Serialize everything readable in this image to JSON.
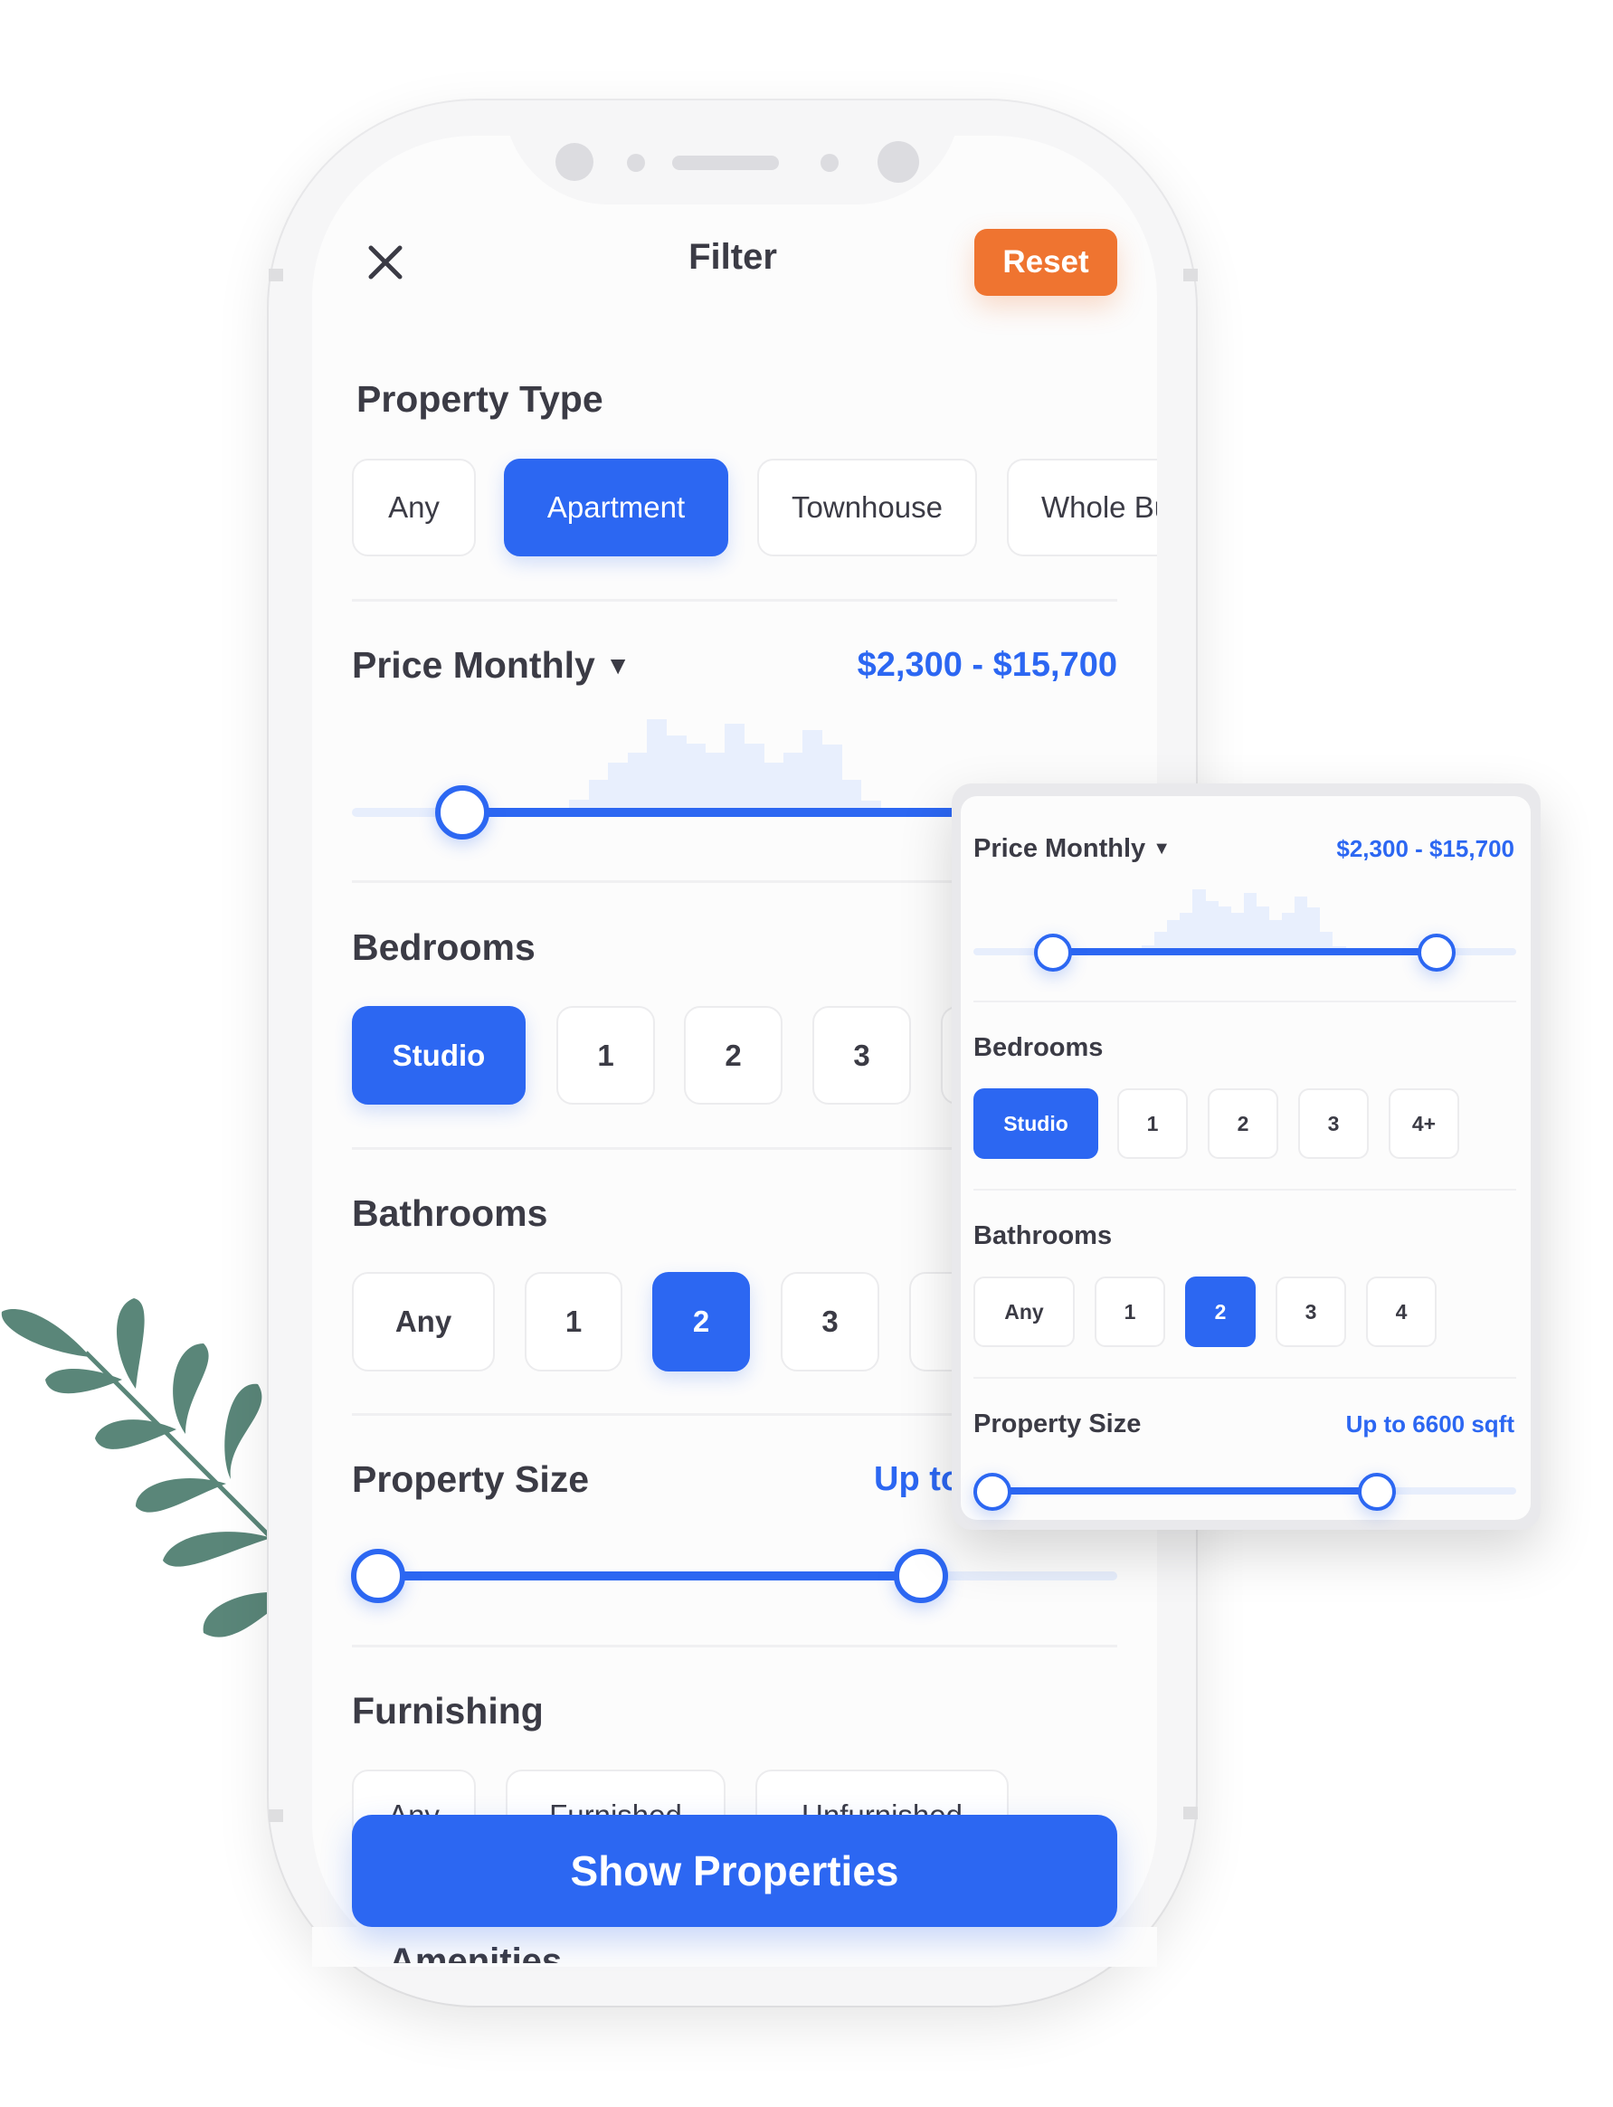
{
  "header": {
    "title": "Filter",
    "close_icon": "close-icon",
    "reset_label": "Reset"
  },
  "colors": {
    "accent_blue": "#2c67f2",
    "reset_orange": "#ef7430",
    "leaf_green": "#5a8679"
  },
  "property_type": {
    "title": "Property Type",
    "options": [
      "Any",
      "Apartment",
      "Townhouse",
      "Whole Bu"
    ],
    "selected": "Apartment"
  },
  "price": {
    "title": "Price Monthly",
    "dropdown_icon": "caret-down-icon",
    "range_label": "$2,300 - $15,700",
    "histogram": [
      0.11,
      0.33,
      0.52,
      0.63,
      1.0,
      0.82,
      0.73,
      0.63,
      0.95,
      0.73,
      0.52,
      0.63,
      0.88,
      0.72,
      0.33,
      0.1
    ],
    "min_fraction": 0.16,
    "max_fraction": 0.81
  },
  "bedrooms": {
    "title": "Bedrooms",
    "options": [
      "Studio",
      "1",
      "2",
      "3",
      "4+"
    ],
    "selected": "Studio"
  },
  "bathrooms": {
    "title": "Bathrooms",
    "options": [
      "Any",
      "1",
      "2",
      "3",
      "4"
    ],
    "selected": "2"
  },
  "property_size": {
    "title": "Property Size",
    "value_label": "Up to 6600 sqft",
    "value_label_truncated": "Up to",
    "min_fraction": 0.0,
    "max_fraction": 0.7
  },
  "furnishing": {
    "title": "Furnishing",
    "options": [
      "Any",
      "Furnished",
      "Unfurnished"
    ]
  },
  "show_button_label": "Show Properties",
  "next_section_partial": "Amenities"
}
